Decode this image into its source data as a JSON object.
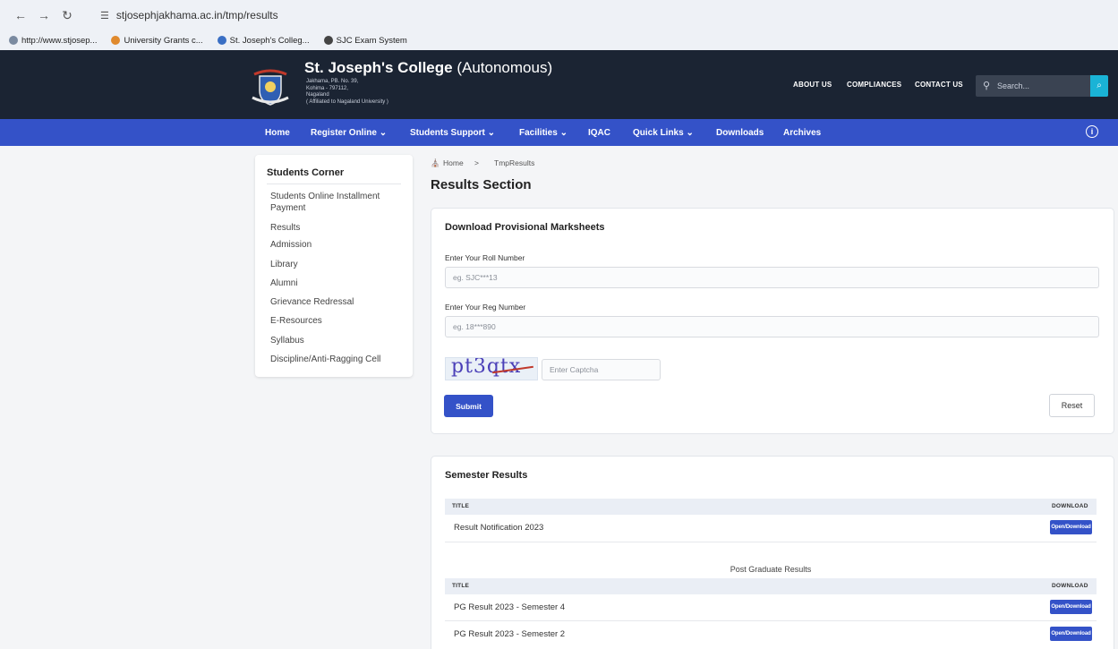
{
  "browser": {
    "url": "stjosephjakhama.ac.in/tmp/results",
    "bookmarks": [
      "http://www.stjosep...",
      "University Grants c...",
      "St. Joseph's Colleg...",
      "SJC Exam System"
    ]
  },
  "header": {
    "college_name": "St. Joseph's College",
    "college_suffix": "(Autonomous)",
    "address_lines": [
      "Jakhama, PB. No. 39,",
      "Kohima - 797112,",
      "Nagaland",
      "( Affiliated to Nagaland University )"
    ],
    "top_links": [
      "ABOUT US",
      "COMPLIANCES",
      "CONTACT US"
    ],
    "search_placeholder": "Search..."
  },
  "nav": {
    "items": [
      "Home",
      "Register Online",
      "Students Support",
      "Facilities",
      "IQAC",
      "Quick Links",
      "Downloads",
      "Archives"
    ],
    "accent": "#3452c8"
  },
  "sidebar": {
    "title": "Students Corner",
    "items": [
      "Students Online Installment Payment",
      "Results",
      "Admission",
      "Library",
      "Alumni",
      "Grievance Redressal",
      "E-Resources",
      "Syllabus",
      "Discipline/Anti-Ragging Cell"
    ]
  },
  "breadcrumb": {
    "home": "Home",
    "separator": ">",
    "current": "TmpResults"
  },
  "page_title": "Results Section",
  "marksheet_form": {
    "title": "Download Provisional Marksheets",
    "roll_label": "Enter Your Roll Number",
    "roll_placeholder": "eg. SJC***13",
    "reg_label": "Enter Your Reg Number",
    "reg_placeholder": "eg. 18***890",
    "captcha_text": "pt3qtx",
    "captcha_placeholder": "Enter Captcha",
    "submit_label": "Submit",
    "reset_label": "Reset"
  },
  "semester_results": {
    "title": "Semester Results",
    "col_title": "TITLE",
    "col_download": "DOWNLOAD",
    "rows": [
      {
        "title": "Result Notification 2023",
        "button": "Open/Download"
      }
    ],
    "pg_caption": "Post Graduate Results",
    "pg_rows": [
      {
        "title": "PG Result 2023 - Semester 4",
        "button": "Open/Download"
      },
      {
        "title": "PG Result 2023 - Semester 2",
        "button": "Open/Download"
      }
    ]
  }
}
